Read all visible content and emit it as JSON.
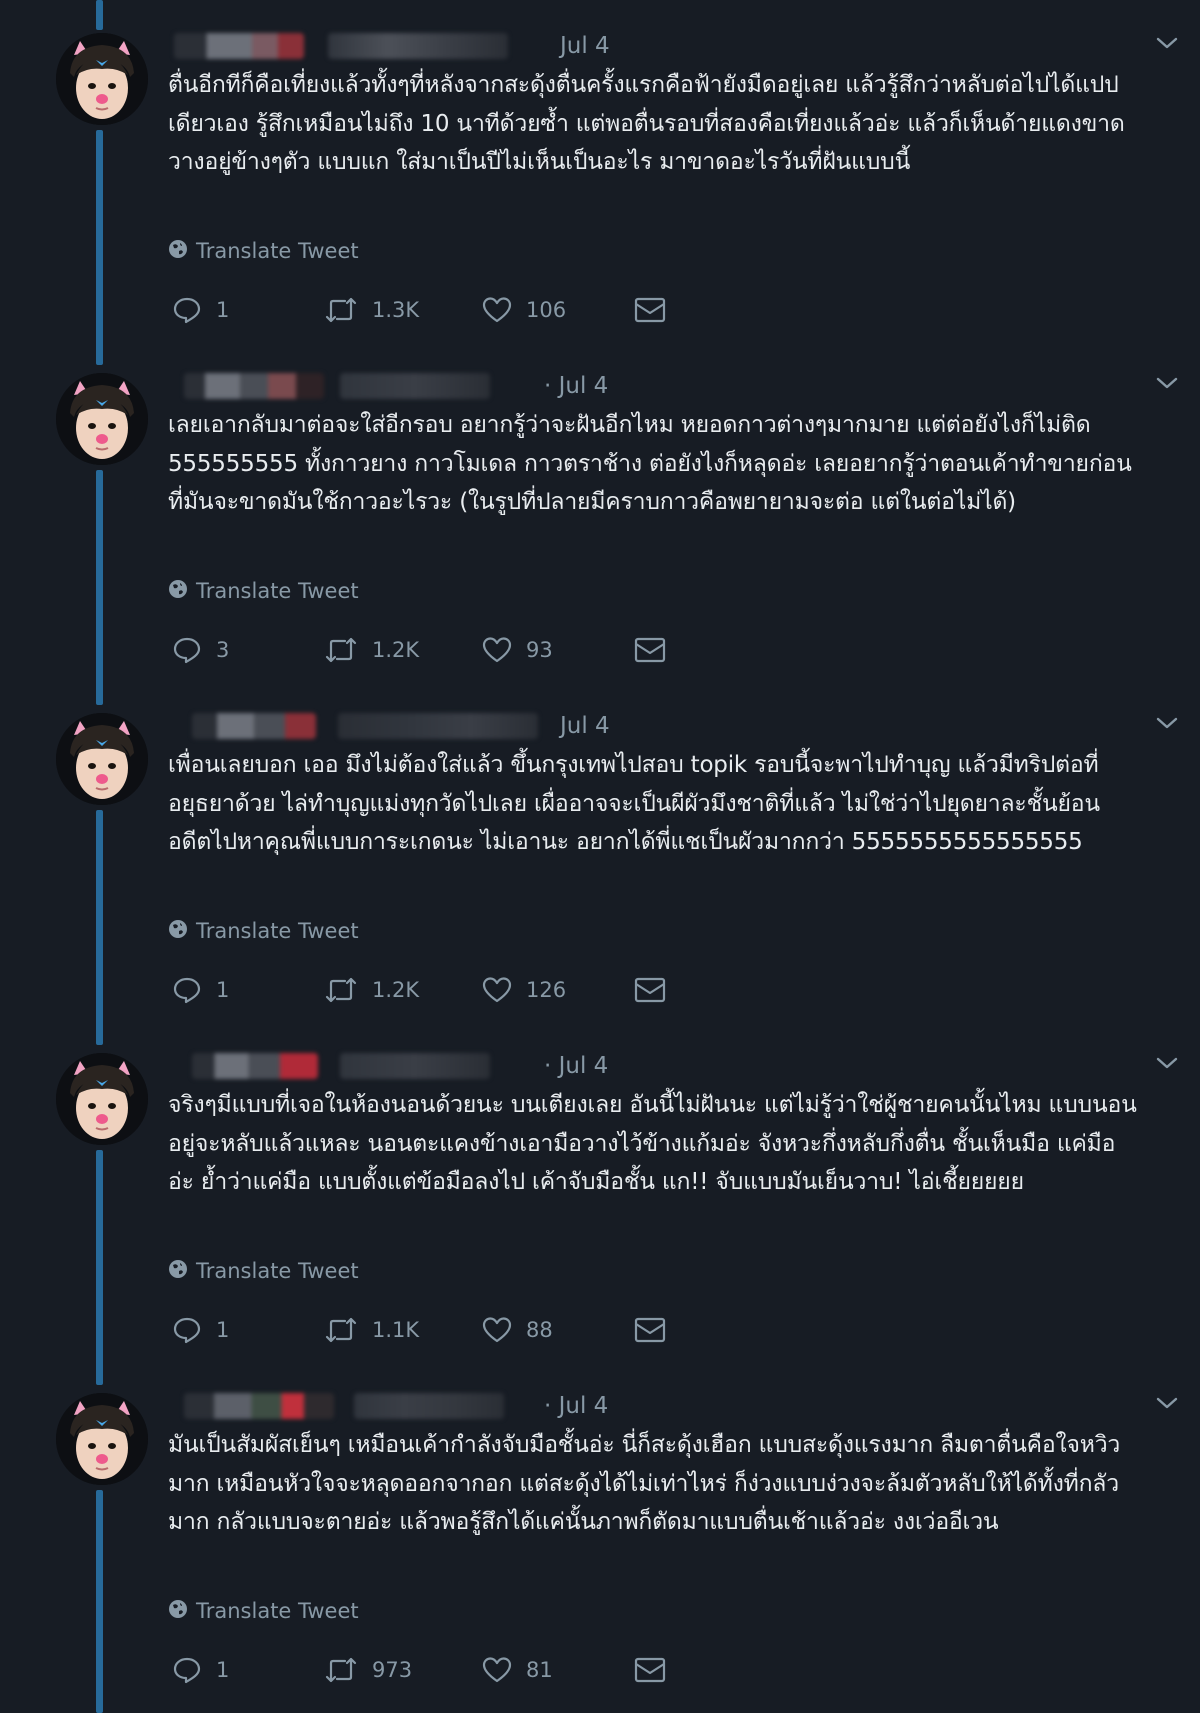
{
  "tweets": [
    {
      "date": "Jul 4",
      "text": "ตื่นอีกทีก็คือเที่ยงแล้วทั้งๆที่หลังจากสะดุ้งตื่นครั้งแรกคือฟ้ายังมืดอยู่เลย แล้วรู้สึกว่าหลับต่อไปได้แปปเดียวเอง รู้สึกเหมือนไม่ถึง 10 นาทีด้วยซ้ำ แต่พอตื่นรอบที่สองคือเที่ยงแล้วอ่ะ แล้วก็เห็นด้ายแดงขาด วางอยู่ข้างๆตัว แบบแก ใส่มาเป็นปีไม่เห็นเป็นอะไร มาขาดอะไรวันที่ฝันแบบนี้",
      "translate": "Translate Tweet",
      "replies": "1",
      "retweets": "1.3K",
      "likes": "106"
    },
    {
      "date": "· Jul 4",
      "text": "เลยเอากลับมาต่อจะใส่อีกรอบ อยากรู้ว่าจะฝันอีกไหม หยอดกาวต่างๆมากมาย แต่ต่อยังไงก็ไม่ติด 555555555 ทั้งกาวยาง กาวโมเดล กาวตราช้าง ต่อยังไงก็หลุดอ่ะ เลยอยากรู้ว่าตอนเค้าทำขายก่อนที่มันจะขาดมันใช้กาวอะไรวะ (ในรูปที่ปลายมีคราบกาวคือพยายามจะต่อ แต่ในต่อไม่ได้)",
      "translate": "Translate Tweet",
      "replies": "3",
      "retweets": "1.2K",
      "likes": "93"
    },
    {
      "date": "Jul 4",
      "text": "เพื่อนเลยบอก เออ มึงไม่ต้องใส่แล้ว ขึ้นกรุงเทพไปสอบ topik รอบนี้จะพาไปทำบุญ แล้วมีทริปต่อที่อยุธยาด้วย ไล่ทำบุญแม่งทุกวัดไปเลย เผื่ออาจจะเป็นผีผัวมึงชาติที่แล้ว ไม่ใช่ว่าไปยุดยาละชั้นย้อนอดีตไปหาคุณพี่แบบการะเกดนะ ไม่เอานะ อยากได้พี่แชเป็นผัวมากกว่า 5555555555555555",
      "translate": "Translate Tweet",
      "replies": "1",
      "retweets": "1.2K",
      "likes": "126"
    },
    {
      "date": "· Jul 4",
      "text": "จริงๆมีแบบที่เจอในห้องนอนด้วยนะ บนเตียงเลย อันนี้ไม่ฝันนะ แต่ไม่รู้ว่าใช่ผู้ชายคนนั้นไหม แบบนอนอยู่จะหลับแล้วแหละ นอนตะแคงข้างเอามือวางไว้ข้างแก้มอ่ะ จังหวะกึ่งหลับกึ่งตื่น ชั้นเห็นมือ แค่มืออ่ะ ย้ำว่าแค่มือ แบบตั้งแต่ข้อมือลงไป เค้าจับมือชั้น แก!! จับแบบมันเย็นวาบ! ไอ่เชี้ยยยยย",
      "translate": "Translate Tweet",
      "replies": "1",
      "retweets": "1.1K",
      "likes": "88"
    },
    {
      "date": "· Jul 4",
      "text": "มันเป็นสัมผัสเย็นๆ เหมือนเค้ากำลังจับมือชั้นอ่ะ นี่ก็สะดุ้งเฮือก แบบสะดุ้งแรงมาก ลืมตาตื่นคือใจหวิวมาก เหมือนหัวใจจะหลุดออกจากอก แต่สะดุ้งได้ไม่เท่าไหร่ ก็ง่วงแบบง่วงจะล้มตัวหลับให้ได้ทั้งที่กลัวมาก กลัวแบบจะตายอ่ะ แล้วพอรู้สึกได้แค่นั้นภาพก็ตัดมาแบบตื่นเช้าแล้วอ่ะ งงเว่ออีเวน",
      "translate": "Translate Tweet",
      "replies": "1",
      "retweets": "973",
      "likes": "81"
    }
  ]
}
